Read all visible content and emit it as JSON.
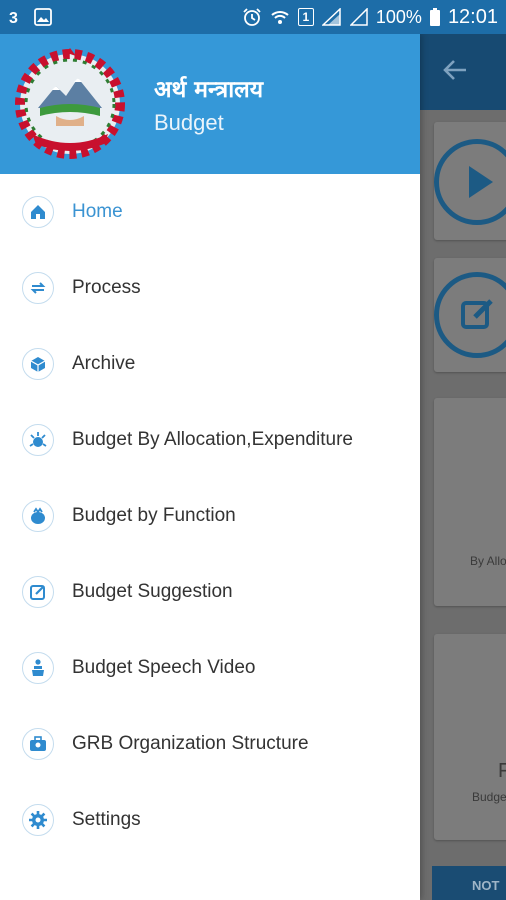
{
  "status_bar": {
    "left_icons": [
      "notification-3-icon",
      "image-icon"
    ],
    "sim_label": "1",
    "battery": "100%",
    "time": "12:01"
  },
  "drawer": {
    "header": {
      "title": "अर्थ मन्त्रालय",
      "subtitle": "Budget",
      "emblem_icon": "nepal-emblem-icon"
    },
    "items": [
      {
        "label": "Home",
        "icon": "home-icon",
        "active": true
      },
      {
        "label": "Process",
        "icon": "process-icon"
      },
      {
        "label": "Archive",
        "icon": "archive-icon"
      },
      {
        "label": "Budget By Allocation,Expenditure",
        "icon": "allocation-icon"
      },
      {
        "label": "Budget by Function",
        "icon": "function-icon"
      },
      {
        "label": "Budget Suggestion",
        "icon": "suggestion-icon"
      },
      {
        "label": "Budget Speech Video",
        "icon": "speech-icon"
      },
      {
        "label": "GRB Organization Structure",
        "icon": "organization-icon"
      },
      {
        "label": "Settings",
        "icon": "settings-icon"
      }
    ]
  },
  "background": {
    "back_icon": "back-arrow-icon",
    "card_texts": [
      "By Allo",
      "F",
      "Budge"
    ],
    "bottom_button": "NOT"
  },
  "colors": {
    "header_blue": "#3598d8",
    "status_blue": "#1d6da8",
    "active_label": "#3a93d2",
    "icon_blue": "#2f8bcf"
  }
}
